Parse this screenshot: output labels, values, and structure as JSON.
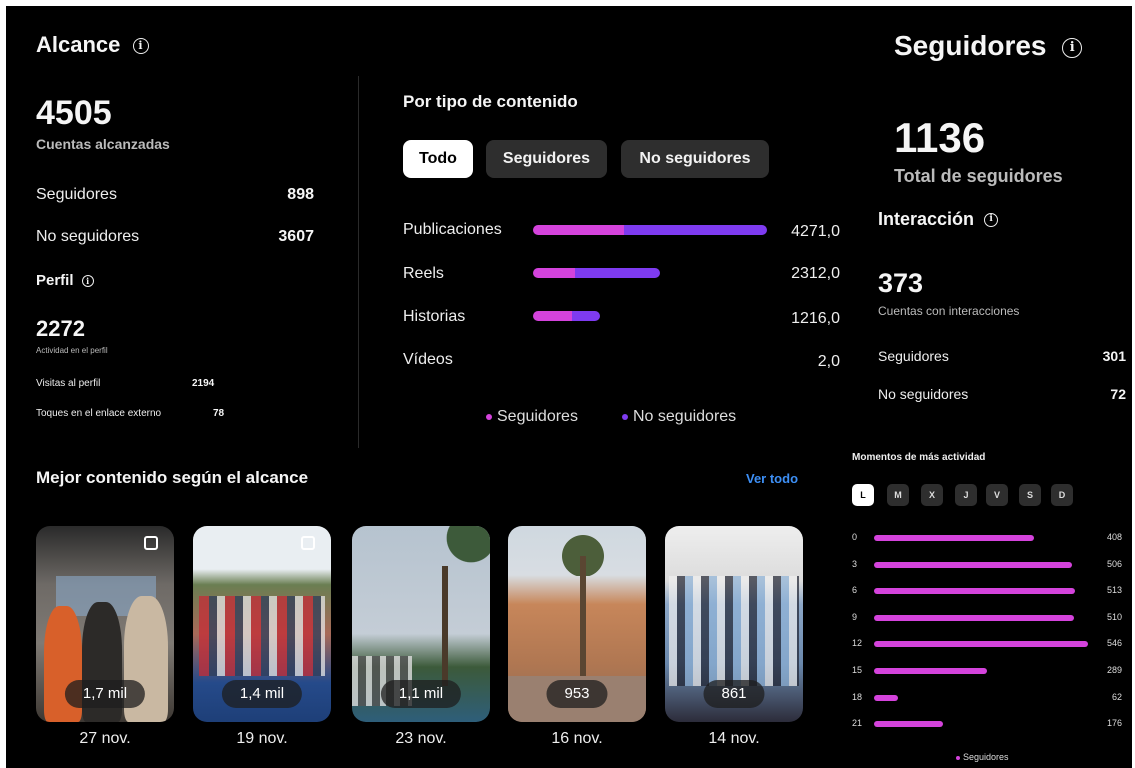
{
  "reach": {
    "title": "Alcance",
    "total": "4505",
    "total_label": "Cuentas alcanzadas",
    "rows": [
      {
        "label": "Seguidores",
        "value": "898"
      },
      {
        "label": "No seguidores",
        "value": "3607"
      }
    ]
  },
  "profile": {
    "title": "Perfil",
    "total": "2272",
    "total_label": "Actividad en el perfil",
    "rows": [
      {
        "label": "Visitas al perfil",
        "value": "2194"
      },
      {
        "label": "Toques en el enlace externo",
        "value": "78"
      }
    ]
  },
  "content_type": {
    "title": "Por tipo de contenido",
    "filters": [
      {
        "label": "Todo",
        "active": true
      },
      {
        "label": "Seguidores",
        "active": false
      },
      {
        "label": "No seguidores",
        "active": false
      }
    ],
    "rows": [
      {
        "label": "Publicaciones",
        "value": "4271,0",
        "followers_fraction": 0.39,
        "total_fraction": 1.0
      },
      {
        "label": "Reels",
        "value": "2312,0",
        "followers_fraction": 0.33,
        "total_fraction": 0.541
      },
      {
        "label": "Historias",
        "value": "1216,0",
        "followers_fraction": 0.58,
        "total_fraction": 0.285
      },
      {
        "label": "Vídeos",
        "value": "2,0",
        "followers_fraction": 0.0,
        "total_fraction": 0.0
      }
    ],
    "legend": [
      {
        "label": "Seguidores",
        "color": "#d443dc"
      },
      {
        "label": "No seguidores",
        "color": "#7e3bf0"
      }
    ]
  },
  "top_content": {
    "title": "Mejor contenido según el alcance",
    "see_all": "Ver todo",
    "items": [
      {
        "reach": "1,7 mil",
        "date": "27 nov.",
        "type_icon": "carousel-icon"
      },
      {
        "reach": "1,4 mil",
        "date": "19 nov.",
        "type_icon": "carousel-icon"
      },
      {
        "reach": "1,1 mil",
        "date": "23 nov.",
        "type_icon": "reel-icon"
      },
      {
        "reach": "953",
        "date": "16 nov.",
        "type_icon": "reel-icon"
      },
      {
        "reach": "861",
        "date": "14 nov.",
        "type_icon": ""
      }
    ]
  },
  "followers": {
    "title": "Seguidores",
    "total": "1136",
    "total_label": "Total de seguidores"
  },
  "interaction": {
    "title": "Interacción",
    "total": "373",
    "total_label": "Cuentas con interacciones",
    "rows": [
      {
        "label": "Seguidores",
        "value": "301"
      },
      {
        "label": "No seguidores",
        "value": "72"
      }
    ]
  },
  "activity": {
    "title": "Momentos de más actividad",
    "days": [
      {
        "label": "L",
        "active": true
      },
      {
        "label": "M",
        "active": false
      },
      {
        "label": "X",
        "active": false
      },
      {
        "label": "J",
        "active": false
      },
      {
        "label": "V",
        "active": false
      },
      {
        "label": "S",
        "active": false
      },
      {
        "label": "D",
        "active": false
      }
    ],
    "hours": [
      {
        "hour": "0",
        "value": 408
      },
      {
        "hour": "3",
        "value": 506
      },
      {
        "hour": "6",
        "value": 513
      },
      {
        "hour": "9",
        "value": 510
      },
      {
        "hour": "12",
        "value": 546
      },
      {
        "hour": "15",
        "value": 289
      },
      {
        "hour": "18",
        "value": 62
      },
      {
        "hour": "21",
        "value": 176
      }
    ],
    "legend": "Seguidores",
    "bar_color": "#d443dc"
  }
}
